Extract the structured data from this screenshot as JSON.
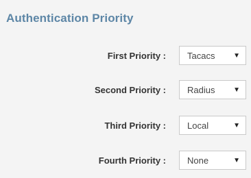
{
  "panel": {
    "title": "Authentication Priority"
  },
  "priorities": [
    {
      "label": "First Priority :",
      "value": "Tacacs"
    },
    {
      "label": "Second Priority :",
      "value": "Radius"
    },
    {
      "label": "Third Priority :",
      "value": "Local"
    },
    {
      "label": "Fourth Priority :",
      "value": "None"
    }
  ],
  "icons": {
    "dropdown": "chevron-down-icon"
  }
}
